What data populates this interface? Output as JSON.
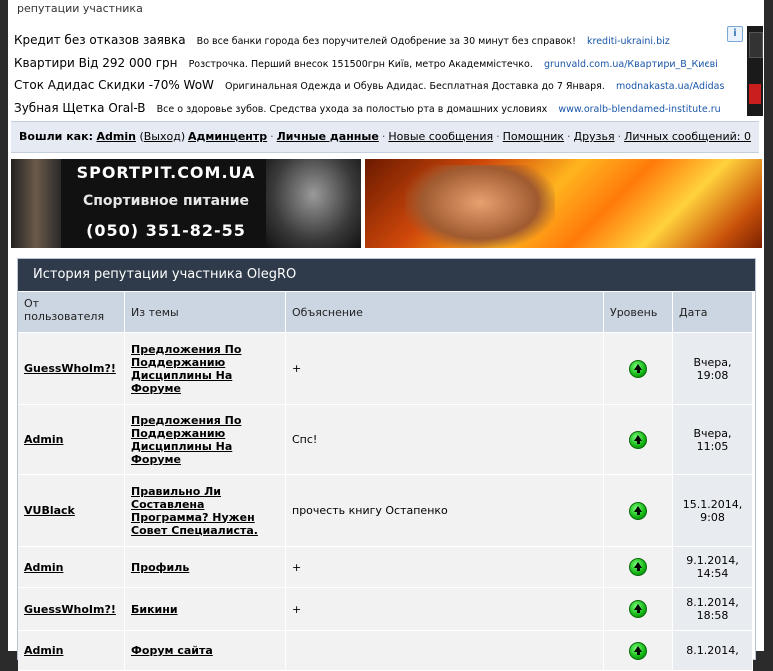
{
  "breadcrumb": "репутации участника",
  "ads": [
    {
      "title": "Кредит без отказов заявка",
      "desc": "Во все банки города без поручителей Одобрение за 30 минут без справок!",
      "url": "krediti-ukraini.biz"
    },
    {
      "title": "Квартири Від 292 000 грн",
      "desc": "Розстрочка. Перший внесок 151500грн Київ, метро Академмістечко.",
      "url": "grunvald.com.ua/Квартири_В_Києві"
    },
    {
      "title": "Сток Адидас Скидки -70% WoW",
      "desc": "Оригинальная Одежда и Обувь Адидас. Бесплатная Доставка до 7 Января.",
      "url": "modnakasta.ua/Adidas"
    },
    {
      "title": "Зубная Щетка Oral-B",
      "desc": "Все о здоровье зубов. Средства ухода за полостью рта в домашних условиях",
      "url": "www.oralb-blendamed-institute.ru"
    }
  ],
  "ad_info_icon": "i",
  "userbar": {
    "logged_as": "Вошли как:",
    "username": "Admin",
    "logout_open": "(",
    "logout": "Выход",
    "logout_close": ")",
    "links": {
      "admincenter": "Админцентр",
      "personal": "Личные данные",
      "new_posts": "Новые сообщения",
      "helper": "Помощник",
      "friends": "Друзья",
      "pm": "Личных сообщений: 0"
    }
  },
  "banner1": {
    "line1": "SPORTPIT.COM.UA",
    "line2": "Спортивное питание",
    "line3": "(050) 351-82-55"
  },
  "panel": {
    "title": "История репутации участника OlegRO",
    "headers": {
      "from": "От пользователя",
      "topic": "Из темы",
      "explanation": "Объяснение",
      "level": "Уровень",
      "date": "Дата"
    },
    "rows": [
      {
        "user": "GuessWhoIm?!",
        "topic": "Предложения По Поддержанию Дисциплины На Форуме",
        "explanation": "+",
        "level": "up-arrow-icon",
        "date": "Вчера, 19:08"
      },
      {
        "user": "Admin",
        "topic": "Предложения По Поддержанию Дисциплины На Форуме",
        "explanation": "Спс!",
        "level": "up-arrow-icon",
        "date": "Вчера, 11:05"
      },
      {
        "user": "VUBlack",
        "topic": "Правильно Ли Составлена Программа? Нужен Совет Специалиста.",
        "explanation": "прочесть книгу Остапенко",
        "level": "up-arrow-icon",
        "date": "15.1.2014, 9:08"
      },
      {
        "user": "Admin",
        "topic": "Профиль",
        "explanation": "+",
        "level": "up-arrow-icon",
        "date": "9.1.2014, 14:54"
      },
      {
        "user": "GuessWhoIm?!",
        "topic": "Бикини",
        "explanation": "+",
        "level": "up-arrow-icon",
        "date": "8.1.2014, 18:58"
      },
      {
        "user": "Admin",
        "topic": "Форум сайта",
        "explanation": "",
        "level": "up-arrow-icon",
        "date": "8.1.2014,"
      }
    ]
  }
}
